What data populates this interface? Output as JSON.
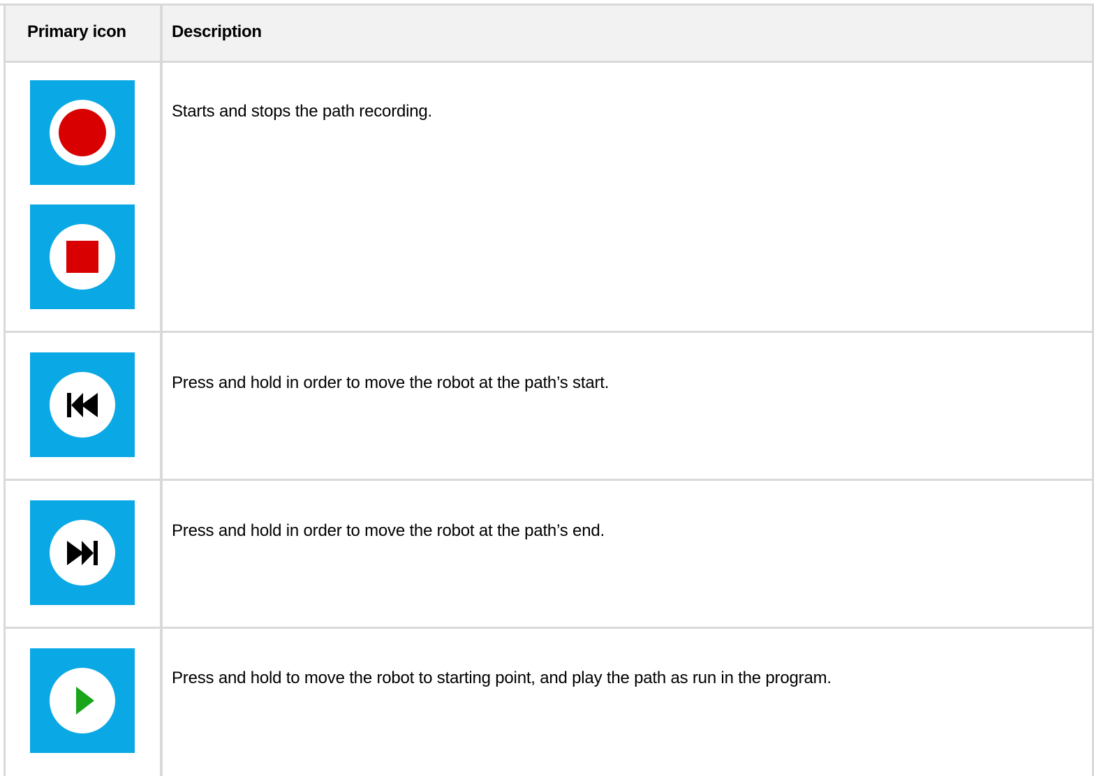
{
  "table": {
    "header": {
      "col_icon": "Primary icon",
      "col_desc": "Description"
    },
    "rows": [
      {
        "icons": [
          "record-icon",
          "stop-icon"
        ],
        "description": "Starts and stops the path recording."
      },
      {
        "icons": [
          "skip-to-start-icon"
        ],
        "description": "Press and hold in order to move the robot at the path’s start."
      },
      {
        "icons": [
          "skip-to-end-icon"
        ],
        "description": "Press and hold in order to move the robot at the path’s end."
      },
      {
        "icons": [
          "play-icon"
        ],
        "description": "Press and hold to move the robot to starting point, and play the path as run in the program."
      }
    ]
  },
  "colors": {
    "tile_blue": "#0aa8e4",
    "record_red": "#d80000",
    "play_green": "#1aa51a",
    "header_bg": "#f2f2f2",
    "grid_line": "#d9d9d9"
  }
}
